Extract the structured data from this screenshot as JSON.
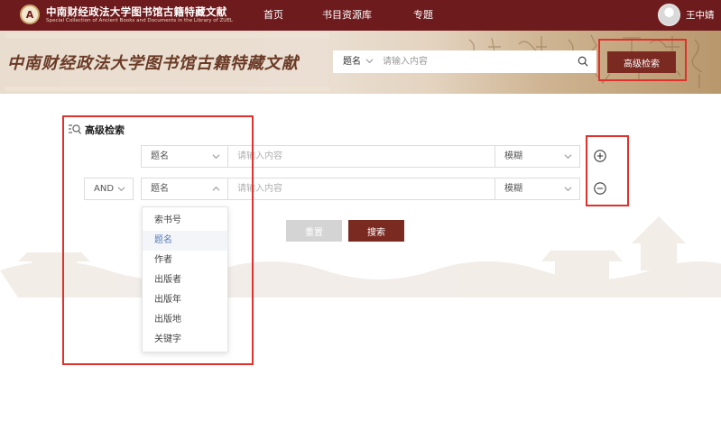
{
  "header": {
    "logo_title": "中南财经政法大学图书馆古籍特藏文献",
    "logo_subtitle": "Special Collection of Ancient Books and Documents in the Library of ZUEL",
    "nav": [
      {
        "label": "首页"
      },
      {
        "label": "书目资源库"
      },
      {
        "label": "专题"
      }
    ],
    "username": "王中婧"
  },
  "banner": {
    "title": "中南财经政法大学图书馆古籍特藏文献",
    "search_field": "题名",
    "search_placeholder": "请输入内容",
    "advanced_button": "高级检索"
  },
  "advanced": {
    "title": "高级检索",
    "rows": [
      {
        "operator": "",
        "field": "题名",
        "placeholder": "请输入内容",
        "match": "模糊",
        "action": "add"
      },
      {
        "operator": "AND",
        "field": "题名",
        "placeholder": "请输入内容",
        "match": "模糊",
        "action": "remove"
      }
    ],
    "reset_label": "重置",
    "search_label": "搜索",
    "dropdown_options": [
      "索书号",
      "题名",
      "作者",
      "出版者",
      "出版年",
      "出版地",
      "关键字"
    ],
    "dropdown_selected": "题名"
  },
  "colors": {
    "brand": "#6e1b1d",
    "button": "#7b2a22",
    "highlight": "#e0312c"
  }
}
